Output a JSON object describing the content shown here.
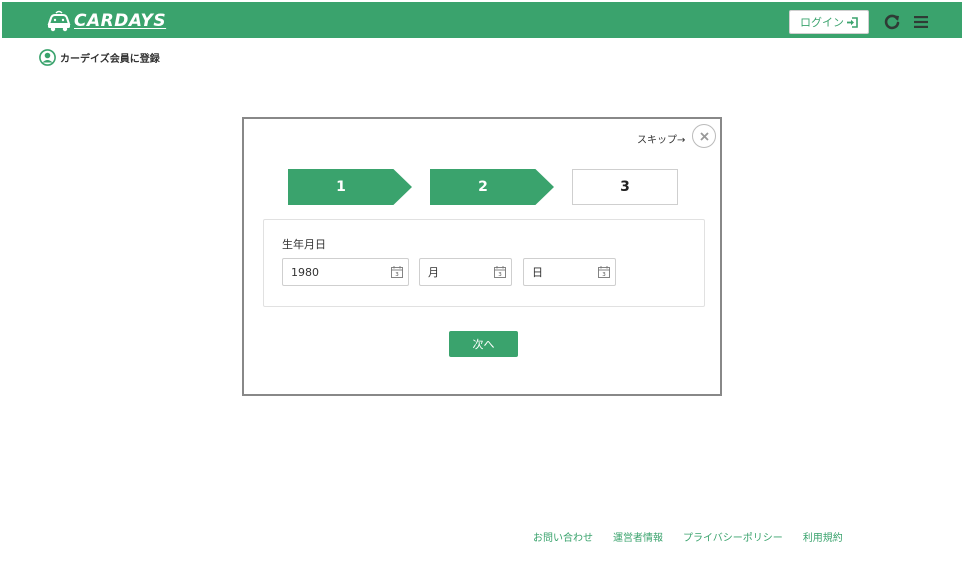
{
  "header": {
    "brand": "CARDAYS",
    "login_label": "ログイン",
    "accent": "#3aa36d",
    "icons": [
      "car-logo-icon",
      "login-arrow-icon",
      "refresh-icon",
      "hamburger-menu-icon"
    ]
  },
  "register": {
    "label": "カーデイズ会員に登録",
    "icon": "user-circle-icon"
  },
  "modal": {
    "skip_label": "スキップ→",
    "steps": [
      {
        "label": "1",
        "state": "done"
      },
      {
        "label": "2",
        "state": "current"
      },
      {
        "label": "3",
        "state": "pending"
      }
    ],
    "birthdate": {
      "label": "生年月日",
      "year_value": "1980",
      "month_value": "月",
      "day_value": "日"
    },
    "next_label": "次へ"
  },
  "footer": {
    "links": [
      "お問い合わせ",
      "運営者情報",
      "プライバシーポリシー",
      "利用規約"
    ]
  }
}
